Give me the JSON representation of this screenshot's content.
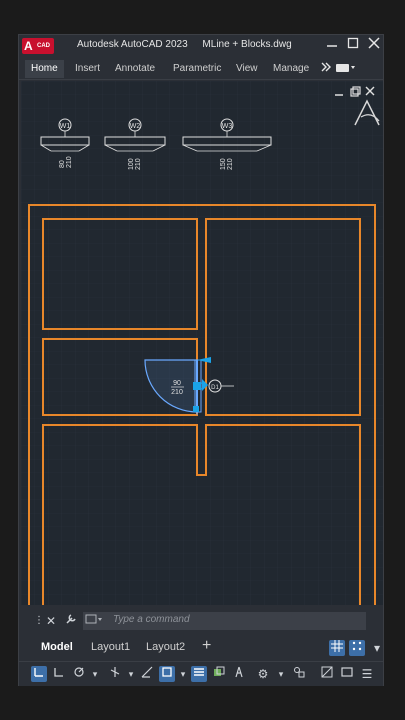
{
  "window": {
    "app_title": "Autodesk AutoCAD 2023",
    "document_title": "MLine + Blocks.dwg",
    "logo_letter": "A",
    "logo_text": "CAD",
    "minimize_icon": "minimize-icon",
    "maximize_icon": "maximize-icon",
    "close_icon": "close-icon"
  },
  "ribbon": {
    "tabs": [
      "Home",
      "Insert",
      "Annotate",
      "Parametric",
      "View",
      "Manage"
    ],
    "active_tab": "Home",
    "overflow_icon": "double-chevron-right-icon"
  },
  "wall_blocks": [
    {
      "tag": "W1",
      "width": "80",
      "height": "210"
    },
    {
      "tag": "W2",
      "width": "100",
      "height": "210"
    },
    {
      "tag": "W3",
      "width": "150",
      "height": "210"
    }
  ],
  "door": {
    "width": "90",
    "height": "210",
    "tag": "D1"
  },
  "command": {
    "placeholder": "Type a command"
  },
  "layout_tabs": [
    "Model",
    "Layout1",
    "Layout2"
  ],
  "colors": {
    "wall": "#e8872a",
    "canvas": "#212830",
    "selection": "#6aa9ff",
    "grip": "#1aa3e8",
    "chrome": "#2b2f36"
  }
}
